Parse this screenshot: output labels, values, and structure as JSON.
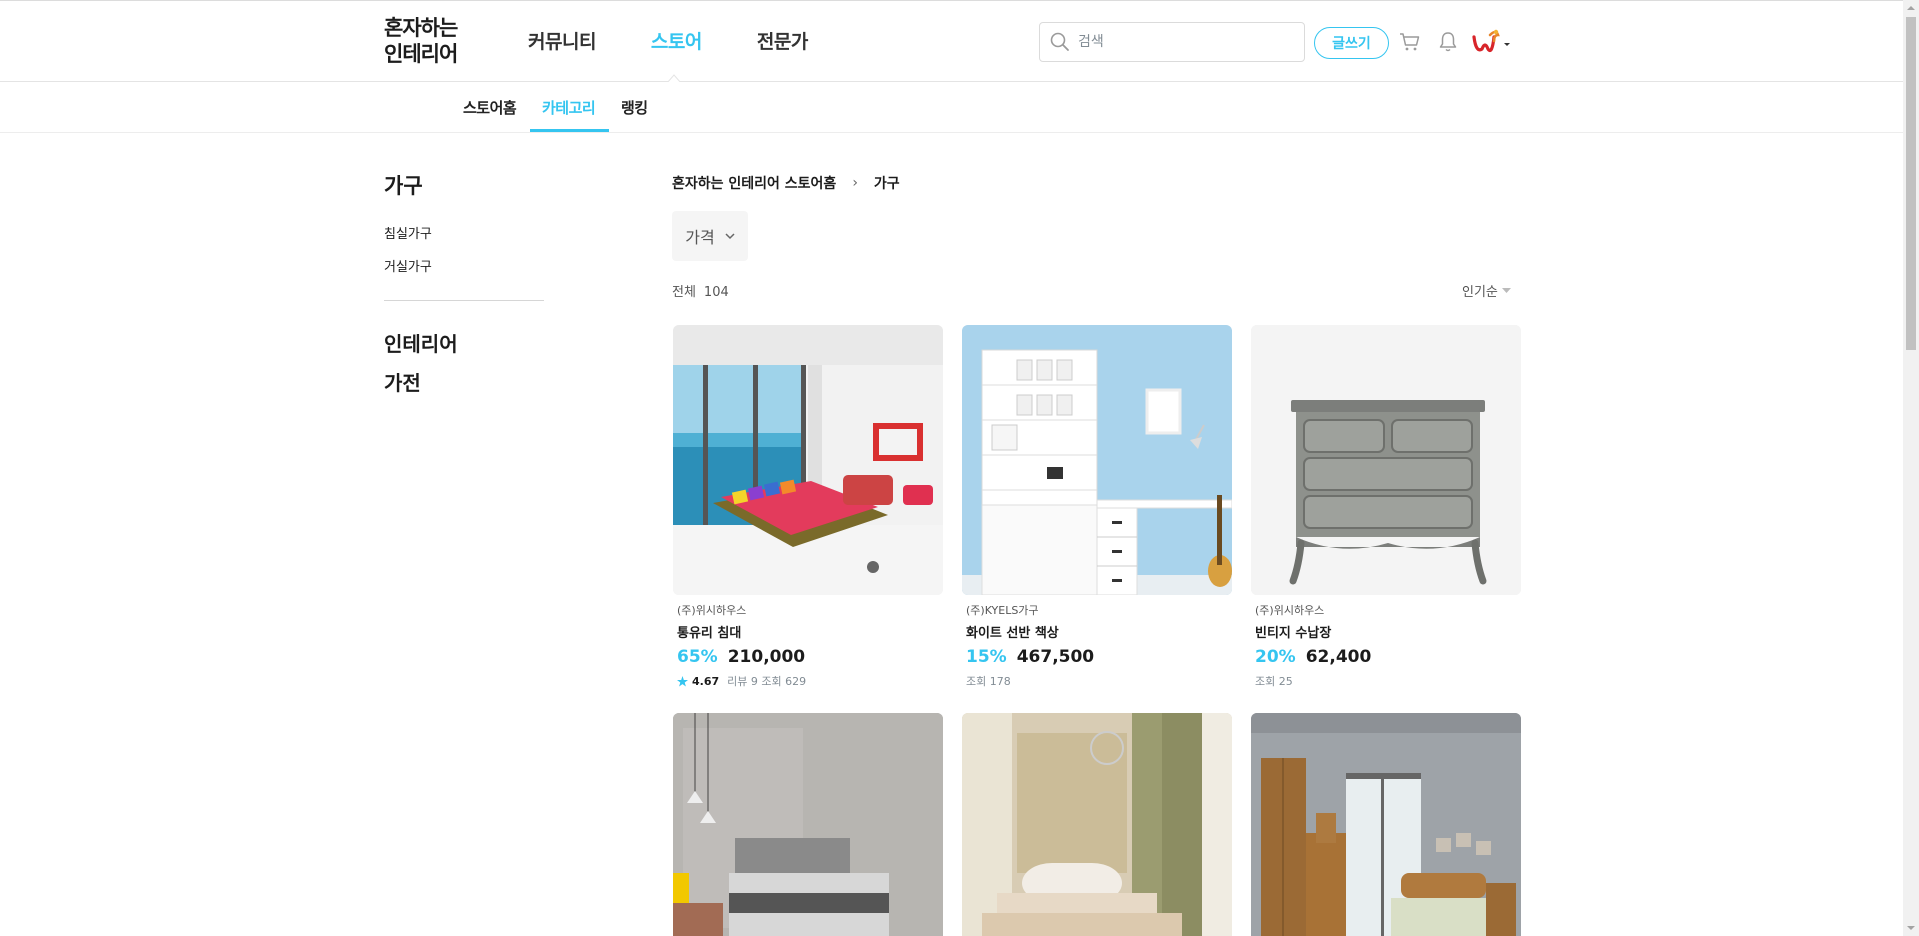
{
  "header": {
    "logo_line1": "혼자하는",
    "logo_line2": "인테리어",
    "nav": [
      "커뮤니티",
      "스토어",
      "전문가"
    ],
    "search_placeholder": "검색",
    "write_label": "글쓰기"
  },
  "subnav": {
    "items": [
      "스토어홈",
      "카테고리",
      "랭킹"
    ]
  },
  "sidebar": {
    "title": "가구",
    "subs": [
      "침실가구",
      "거실가구"
    ],
    "cats": [
      "인테리어",
      "가전"
    ]
  },
  "main": {
    "breadcrumb_home": "혼자하는 인테리어 스토어홈",
    "breadcrumb_sep": "›",
    "breadcrumb_current": "가구",
    "filter_label": "가격",
    "count_label": "전체",
    "count_value": "104",
    "sort_label": "인기순"
  },
  "products": [
    {
      "brand": "(주)위시하우스",
      "name": "통유리 침대",
      "discount": "65%",
      "price": "210,000",
      "rating": "4.67",
      "meta": "리뷰 9 조회 629"
    },
    {
      "brand": "(주)KYELS가구",
      "name": "화이트 선반 책상",
      "discount": "15%",
      "price": "467,500",
      "meta": "조회 178"
    },
    {
      "brand": "(주)위시하우스",
      "name": "빈티지 수납장",
      "discount": "20%",
      "price": "62,400",
      "meta": "조회 25"
    }
  ],
  "colors": {
    "accent": "#35c5f0",
    "text": "#1c1c1c"
  }
}
